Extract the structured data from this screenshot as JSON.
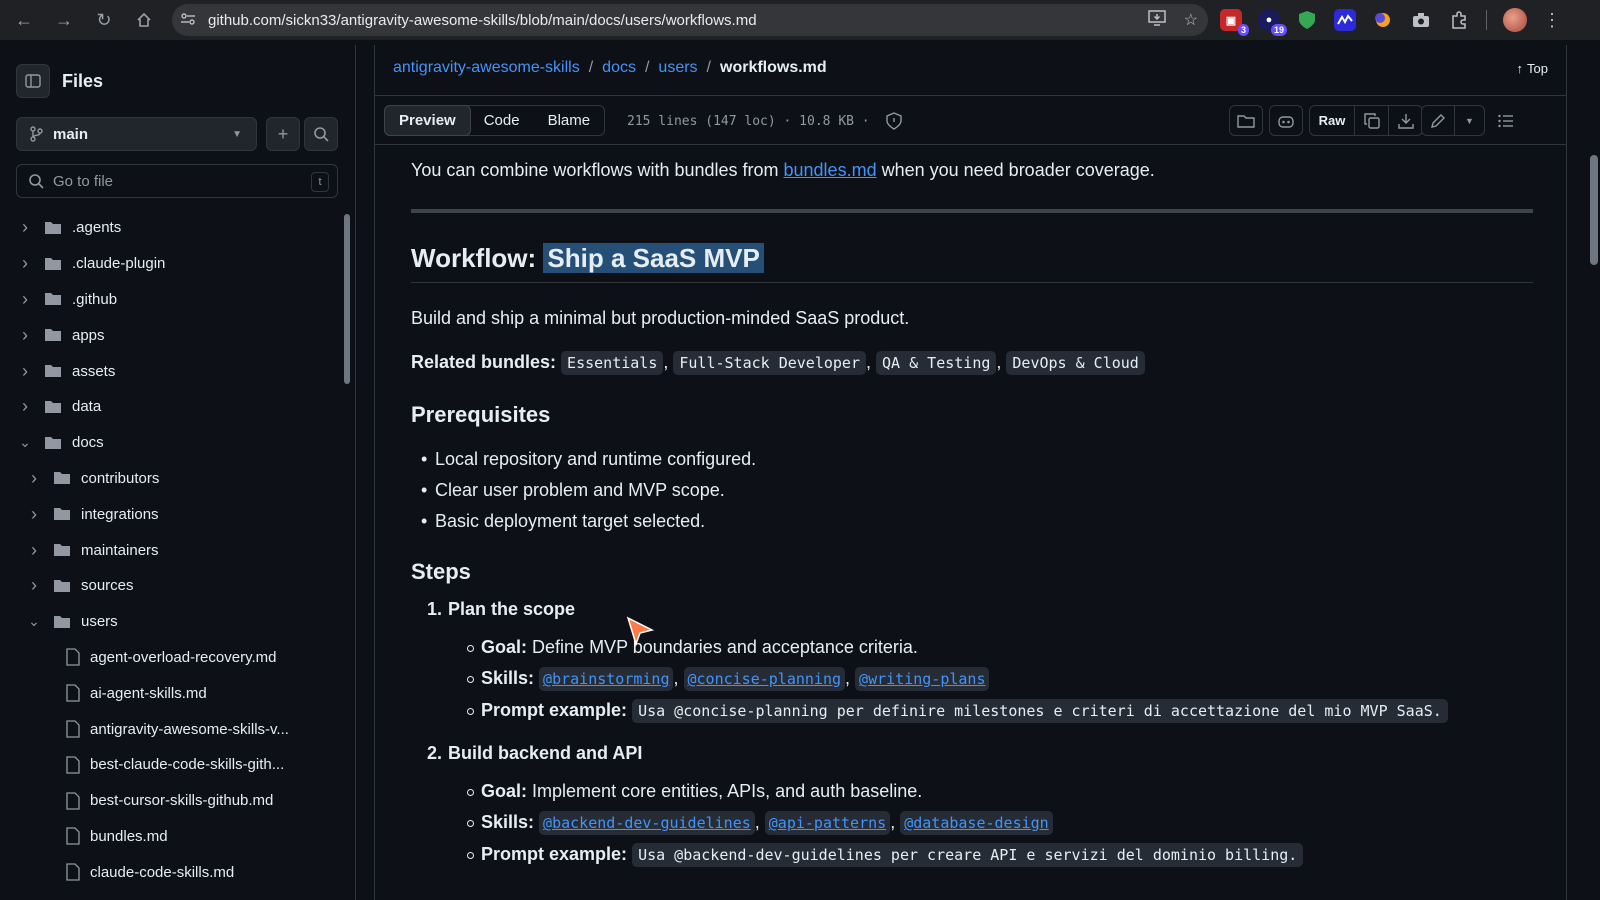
{
  "browser": {
    "url": "github.com/sickn33/antigravity-awesome-skills/blob/main/docs/users/workflows.md",
    "ext_badges": [
      "3",
      "19"
    ]
  },
  "sidebar": {
    "title": "Files",
    "branch": "main",
    "goto_placeholder": "Go to file",
    "goto_shortcut": "t",
    "tree": [
      {
        "label": ".agents",
        "type": "folder",
        "expanded": false,
        "depth": 0
      },
      {
        "label": ".claude-plugin",
        "type": "folder",
        "expanded": false,
        "depth": 0
      },
      {
        "label": ".github",
        "type": "folder",
        "expanded": false,
        "depth": 0
      },
      {
        "label": "apps",
        "type": "folder",
        "expanded": false,
        "depth": 0
      },
      {
        "label": "assets",
        "type": "folder",
        "expanded": false,
        "depth": 0
      },
      {
        "label": "data",
        "type": "folder",
        "expanded": false,
        "depth": 0
      },
      {
        "label": "docs",
        "type": "folder",
        "expanded": true,
        "depth": 0
      },
      {
        "label": "contributors",
        "type": "folder",
        "expanded": false,
        "depth": 1
      },
      {
        "label": "integrations",
        "type": "folder",
        "expanded": false,
        "depth": 1
      },
      {
        "label": "maintainers",
        "type": "folder",
        "expanded": false,
        "depth": 1
      },
      {
        "label": "sources",
        "type": "folder",
        "expanded": false,
        "depth": 1
      },
      {
        "label": "users",
        "type": "folder",
        "expanded": true,
        "depth": 1
      },
      {
        "label": "agent-overload-recovery.md",
        "type": "file",
        "depth": 2
      },
      {
        "label": "ai-agent-skills.md",
        "type": "file",
        "depth": 2
      },
      {
        "label": "antigravity-awesome-skills-v...",
        "type": "file",
        "depth": 2
      },
      {
        "label": "best-claude-code-skills-gith...",
        "type": "file",
        "depth": 2
      },
      {
        "label": "best-cursor-skills-github.md",
        "type": "file",
        "depth": 2
      },
      {
        "label": "bundles.md",
        "type": "file",
        "depth": 2
      },
      {
        "label": "claude-code-skills.md",
        "type": "file",
        "depth": 2
      }
    ]
  },
  "breadcrumb": {
    "repo": "antigravity-awesome-skills",
    "dir1": "docs",
    "dir2": "users",
    "file": "workflows.md",
    "top_label": "Top"
  },
  "filebar": {
    "tabs": [
      "Preview",
      "Code",
      "Blame"
    ],
    "active_tab": "Preview",
    "meta": "215 lines (147 loc) · 10.8 KB ·",
    "raw_label": "Raw"
  },
  "article": {
    "intro_before": "You can combine workflows with bundles from ",
    "intro_link": "bundles.md",
    "intro_after": " when you need broader coverage.",
    "h2_prefix": "Workflow: ",
    "h2_highlight": "Ship a SaaS MVP",
    "desc": "Build and ship a minimal but production-minded SaaS product.",
    "related_label": "Related bundles:",
    "bundles": [
      "Essentials",
      "Full-Stack Developer",
      "QA & Testing",
      "DevOps & Cloud"
    ],
    "prereq_title": "Prerequisites",
    "prereqs": [
      "Local repository and runtime configured.",
      "Clear user problem and MVP scope.",
      "Basic deployment target selected."
    ],
    "steps_title": "Steps",
    "steps": [
      {
        "num": "1.",
        "title": "Plan the scope",
        "goal_label": "Goal:",
        "goal": "Define MVP boundaries and acceptance criteria.",
        "skills_label": "Skills:",
        "skills": [
          "@brainstorming",
          "@concise-planning",
          "@writing-plans"
        ],
        "prompt_label": "Prompt example:",
        "prompt": "Usa @concise-planning per definire milestones e criteri di accettazione del mio MVP SaaS."
      },
      {
        "num": "2.",
        "title": "Build backend and API",
        "goal_label": "Goal:",
        "goal": "Implement core entities, APIs, and auth baseline.",
        "skills_label": "Skills:",
        "skills": [
          "@backend-dev-guidelines",
          "@api-patterns",
          "@database-design"
        ],
        "prompt_label": "Prompt example:",
        "prompt": "Usa @backend-dev-guidelines per creare API e servizi del dominio billing."
      }
    ]
  },
  "colors": {
    "bg": "#0d1117",
    "link": "#4493f8",
    "border": "#30363d",
    "highlight": "#264f78"
  }
}
